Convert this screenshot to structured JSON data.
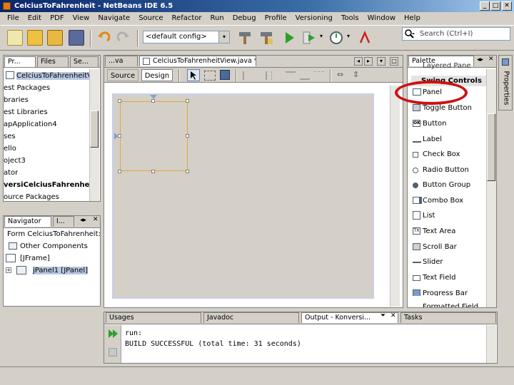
{
  "window": {
    "title": "CelciusToFahrenheit - NetBeans IDE 6.5",
    "minimize_glyph": "_",
    "maximize_glyph": "□",
    "close_glyph": "✕"
  },
  "menu": [
    "File",
    "Edit",
    "PDF",
    "View",
    "Navigate",
    "Source",
    "Refactor",
    "Run",
    "Debug",
    "Profile",
    "Versioning",
    "Tools",
    "Window",
    "Help"
  ],
  "toolbar": {
    "config_value": "<default config>",
    "dropdown_arrow": "▾",
    "search_placeholder": "Search (Ctrl+I)"
  },
  "projects_panel": {
    "tabs": [
      "Pr...",
      "Files",
      "Se..."
    ],
    "items": [
      "CelciusToFahrenheitVi",
      "est Packages",
      "braries",
      "est Libraries",
      "apApplication4",
      "ses",
      "ello",
      "oject3",
      "ator",
      "versiCelciusFahrenheit",
      "ource Packages"
    ],
    "bold_item_index": 9
  },
  "navigator_panel": {
    "tabs": [
      "Navigator",
      "I..."
    ],
    "items": [
      "Form CelciusToFahrenheit:View",
      "Other Components",
      "[JFrame]",
      "jPanel1 [JPanel]"
    ]
  },
  "editor": {
    "tabs": [
      "...va",
      "CelciusToFahrenheitView.java *"
    ],
    "mode_tabs": [
      "Source",
      "Design"
    ],
    "active_mode": "Design"
  },
  "palette": {
    "title": "Palette",
    "truncated_top": "Layered Pane",
    "category": "Swing Controls",
    "items": [
      "Panel",
      "Toggle Button",
      "Button",
      "Label",
      "Check Box",
      "Radio Button",
      "Button Group",
      "Combo Box",
      "List",
      "Text Area",
      "Scroll Bar",
      "Slider",
      "Text Field",
      "Progress Bar",
      "Formatted Field"
    ],
    "icons": [
      "",
      "",
      "OK",
      "",
      "",
      "",
      "",
      "",
      "",
      "TX",
      "",
      "",
      "",
      "",
      ""
    ],
    "properties_label": "Properties"
  },
  "output_panel": {
    "tabs": [
      "Usages",
      "Javadoc",
      "Output - Konversi...",
      "Tasks"
    ],
    "lines": [
      "run:",
      "BUILD SUCCESSFUL (total time: 31 seconds)"
    ]
  },
  "colors": {
    "accent_red": "#cc1111",
    "selection": "#b8c8e0",
    "form_bg": "#d4d0c8",
    "panel_orange": "#e8a33c"
  }
}
